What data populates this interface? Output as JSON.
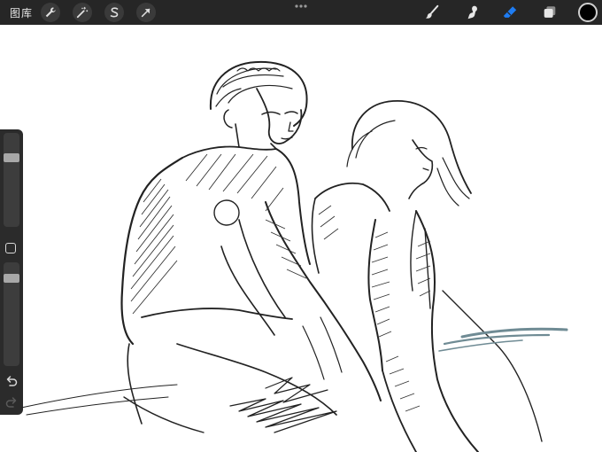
{
  "toolbar": {
    "gallery_label": "图库",
    "left_tools": [
      {
        "name": "actions",
        "icon": "wrench-icon"
      },
      {
        "name": "adjustments",
        "icon": "magic-wand-icon"
      },
      {
        "name": "selection",
        "icon": "selection-s-icon"
      },
      {
        "name": "transform",
        "icon": "arrow-cursor-icon"
      }
    ],
    "right_tools": [
      {
        "name": "brush",
        "icon": "brush-icon",
        "active": false
      },
      {
        "name": "smudge",
        "icon": "smudge-icon",
        "active": false
      },
      {
        "name": "eraser",
        "icon": "eraser-icon",
        "active": true
      },
      {
        "name": "layers",
        "icon": "layers-icon",
        "active": false
      }
    ],
    "current_color": "#000000",
    "active_tool_color": "#1e7cf2"
  },
  "sidebar": {
    "brush_size": 0.76,
    "brush_opacity": 0.88
  }
}
